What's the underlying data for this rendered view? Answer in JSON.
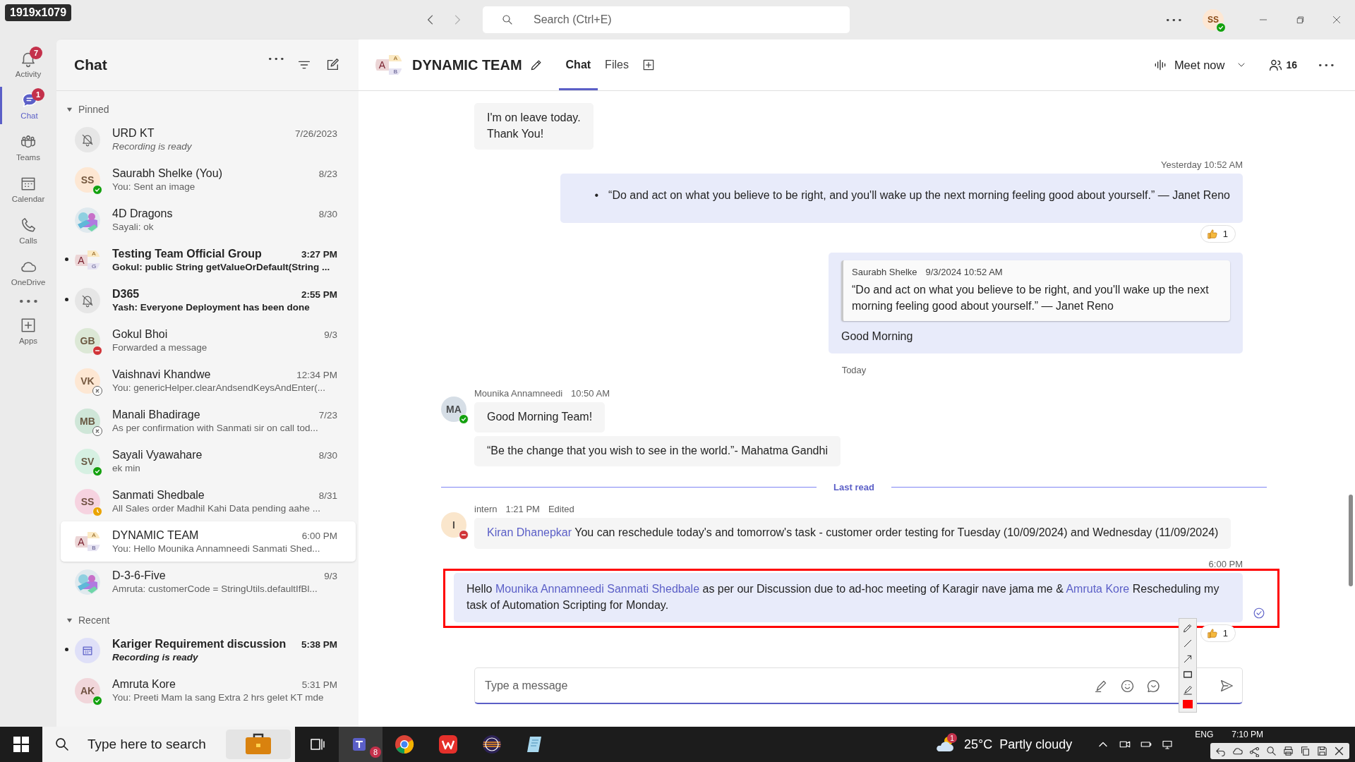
{
  "capture_size_label": "1919x1079",
  "title_bar": {
    "search": {
      "placeholder": "Search (Ctrl+E)"
    },
    "profile": {
      "initials": "SS",
      "presence": {
        "kind": "available"
      }
    }
  },
  "left_rail": [
    {
      "kind": "bell",
      "label": "Activity",
      "badge": "7",
      "selected": false
    },
    {
      "kind": "chat",
      "label": "Chat",
      "badge": "1",
      "selected": true
    },
    {
      "kind": "teams",
      "label": "Teams",
      "selected": false
    },
    {
      "kind": "calendar",
      "label": "Calendar",
      "selected": false
    },
    {
      "kind": "calls",
      "label": "Calls",
      "selected": false
    },
    {
      "kind": "cloud",
      "label": "OneDrive",
      "selected": false
    },
    {
      "kind": "more",
      "selected": false
    },
    {
      "kind": "apps",
      "label": "Apps",
      "selected": false
    }
  ],
  "chat_list": {
    "title": "Chat",
    "sections": [
      {
        "title": "Pinned",
        "expanded": true,
        "items": [
          {
            "name": "URD KT",
            "time": "7/26/2023",
            "preview": "Recording is ready",
            "system_message": true,
            "unread": false,
            "selected": false,
            "avatar": {
              "kind": "muted"
            }
          },
          {
            "name": "Saurabh Shelke (You)",
            "time": "8/23",
            "preview": "You: Sent an image",
            "system_message": false,
            "unread": false,
            "selected": false,
            "presence": {
              "kind": "available"
            },
            "avatar": {
              "kind": "initials",
              "initials": "SS",
              "color": "#fde7d3"
            }
          },
          {
            "name": "4D Dragons",
            "time": "8/30",
            "preview": "Sayali: ok",
            "system_message": false,
            "unread": false,
            "selected": false
          },
          {
            "name": "Testing Team Official Group",
            "time": "3:27 PM",
            "preview": "Gokul: public String getValueOrDefault(String ...",
            "system_message": false,
            "unread": true,
            "selected": false,
            "avatar": {
              "kind": "group",
              "letters": [
                "A",
                "A",
                "G"
              ]
            }
          },
          {
            "name": "D365",
            "time": "2:55 PM",
            "preview": "Yash: Everyone Deployment has been done",
            "system_message": false,
            "unread": true,
            "selected": false,
            "avatar": {
              "kind": "muted"
            }
          },
          {
            "name": "Gokul Bhoi",
            "time": "9/3",
            "preview": "Forwarded a message",
            "system_message": false,
            "unread": false,
            "selected": false,
            "presence": {
              "kind": "busy"
            },
            "avatar": {
              "kind": "initials",
              "initials": "GB",
              "color": "#dce8d6"
            }
          },
          {
            "name": "Vaishnavi Khandwe",
            "time": "12:34 PM",
            "preview": "You: genericHelper.clearAndsendKeysAndEnter(...",
            "system_message": false,
            "unread": false,
            "selected": false,
            "presence": {
              "kind": "offline"
            },
            "avatar": {
              "kind": "initials",
              "initials": "VK",
              "color": "#fde7d3"
            }
          },
          {
            "name": "Manali Bhadirage",
            "time": "7/23",
            "preview": "As per confirmation with Sanmati sir on call tod...",
            "system_message": false,
            "unread": false,
            "selected": false,
            "presence": {
              "kind": "offline"
            },
            "avatar": {
              "kind": "initials",
              "initials": "MB",
              "color": "#cfe6d8"
            }
          },
          {
            "name": "Sayali Vyawahare",
            "time": "8/30",
            "preview": "ek min",
            "system_message": false,
            "unread": false,
            "selected": false,
            "presence": {
              "kind": "available"
            },
            "avatar": {
              "kind": "initials",
              "initials": "SV",
              "color": "#d6f0e2"
            }
          },
          {
            "name": "Sanmati Shedbale",
            "time": "8/31",
            "preview": "All Sales order Madhil Kahi Data pending aahe ...",
            "system_message": false,
            "unread": false,
            "selected": false,
            "presence": {
              "kind": "away"
            },
            "avatar": {
              "kind": "initials",
              "initials": "SS",
              "color": "#f6d3e0"
            }
          },
          {
            "name": "DYNAMIC TEAM",
            "time": "6:00 PM",
            "preview": "You: Hello Mounika Annamneedi Sanmati Shed...",
            "system_message": false,
            "unread": false,
            "selected": true,
            "avatar": {
              "kind": "group",
              "letters": [
                "A",
                "A",
                "B"
              ]
            }
          },
          {
            "name": "D-3-6-Five",
            "time": "9/3",
            "preview": "Amruta: customerCode = StringUtils.defaultIfBl...",
            "system_message": false,
            "unread": false,
            "selected": false
          }
        ]
      },
      {
        "title": "Recent",
        "expanded": true,
        "items": [
          {
            "name": "Kariger Requirement discussion",
            "time": "5:38 PM",
            "preview": "Recording is ready",
            "system_message": true,
            "unread": true,
            "selected": false,
            "avatar": {
              "kind": "meeting"
            }
          },
          {
            "name": "Amruta Kore",
            "time": "5:31 PM",
            "preview": "You: Preeti Mam la sang Extra 2 hrs gelet KT mde",
            "system_message": false,
            "unread": false,
            "selected": false,
            "presence": {
              "kind": "available"
            },
            "avatar": {
              "kind": "initials",
              "initials": "AK",
              "color": "#f1d6da"
            }
          }
        ]
      }
    ]
  },
  "conversation": {
    "title": "DYNAMIC TEAM",
    "avatar": {
      "letters": [
        "A",
        "A",
        "B"
      ]
    },
    "tabs": [
      {
        "label": "Chat",
        "selected": true
      },
      {
        "label": "Files",
        "selected": false
      }
    ],
    "meet_now": "Meet now",
    "participants": "16",
    "messages": [
      {
        "kind": "incoming",
        "bubbles": [
          {
            "parts": [
              {
                "text": "I'm on leave today.\nThank You!",
                "mention": false
              }
            ]
          }
        ]
      },
      {
        "kind": "outgoing",
        "time": "Yesterday 10:52 AM",
        "bullets": [
          {
            "marker": "•",
            "text": "“Do and act on what you believe to be right, and you'll wake up the next morning feeling good about yourself.” — Janet Reno"
          }
        ],
        "reaction": {
          "count": "1"
        },
        "seen": false,
        "highlighted": false
      },
      {
        "kind": "outgoing",
        "quote": {
          "author": "Saurabh Shelke",
          "time": "9/3/2024 10:52 AM",
          "text": "“Do and act on what you believe to be right, and you'll wake up the next morning feeling good about yourself.” — Janet Reno"
        },
        "parts": [
          {
            "text": "Good Morning",
            "mention": false
          }
        ],
        "seen": false,
        "highlighted": false
      },
      {
        "kind": "date",
        "text": "Today"
      },
      {
        "kind": "incoming",
        "sender": "Mounika Annamneedi",
        "time": "10:50 AM",
        "avatar": {
          "initials": "MA",
          "color": "#d6dee6"
        },
        "presence": {
          "kind": "available"
        },
        "bubbles": [
          {
            "parts": [
              {
                "text": "Good Morning Team!",
                "mention": false
              }
            ]
          },
          {
            "parts": [
              {
                "text": "“Be the change that you wish to see in the world.”- Mahatma Gandhi",
                "mention": false
              }
            ]
          }
        ]
      },
      {
        "kind": "last_read",
        "text": "Last read"
      },
      {
        "kind": "incoming",
        "sender": "intern",
        "time": "1:21 PM",
        "edited": "Edited",
        "avatar": {
          "initials": "I",
          "color": "#fae6cc"
        },
        "presence": {
          "kind": "busy"
        },
        "bubbles": [
          {
            "parts": [
              {
                "text": "Kiran Dhanepkar",
                "mention": true
              },
              {
                "text": " You can reschedule today's and tomorrow's task - customer order testing for Tuesday (10/09/2024) and Wednesday (11/09/2024)",
                "mention": false
              }
            ]
          }
        ]
      },
      {
        "kind": "outgoing",
        "time": "6:00 PM",
        "parts": [
          {
            "text": "Hello ",
            "mention": false
          },
          {
            "text": "Mounika Annamneedi",
            "mention": true
          },
          {
            "text": "Sanmati Shedbale",
            "mention": true
          },
          {
            "text": " as per our Discussion due to ad-hoc meeting of Karagir nave jama me & ",
            "mention": false
          },
          {
            "text": "Amruta Kore",
            "mention": true
          },
          {
            "text": " Rescheduling my task of Automation Scripting for Monday.",
            "mention": false
          }
        ],
        "reaction": {
          "count": "1"
        },
        "seen": true,
        "highlighted": true
      }
    ],
    "compose": {
      "placeholder": "Type a message"
    }
  },
  "taskbar": {
    "search": {
      "placeholder": "Type here to search"
    },
    "teams_badge": "8",
    "weather": {
      "badge": "1",
      "temperature": "25°C",
      "condition": "Partly cloudy"
    },
    "language": "ENG",
    "clock": "7:10 PM"
  }
}
